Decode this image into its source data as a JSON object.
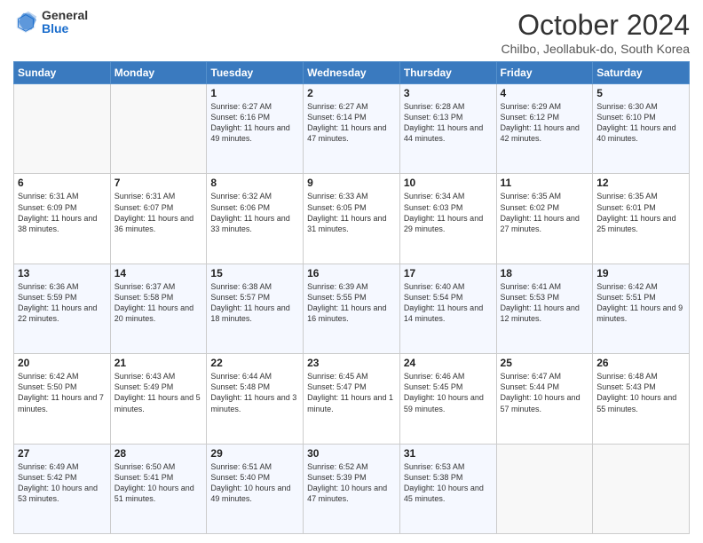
{
  "logo": {
    "general": "General",
    "blue": "Blue"
  },
  "header": {
    "month": "October 2024",
    "location": "Chilbo, Jeollabuk-do, South Korea"
  },
  "days_of_week": [
    "Sunday",
    "Monday",
    "Tuesday",
    "Wednesday",
    "Thursday",
    "Friday",
    "Saturday"
  ],
  "weeks": [
    [
      {
        "day": "",
        "info": ""
      },
      {
        "day": "",
        "info": ""
      },
      {
        "day": "1",
        "info": "Sunrise: 6:27 AM\nSunset: 6:16 PM\nDaylight: 11 hours and 49 minutes."
      },
      {
        "day": "2",
        "info": "Sunrise: 6:27 AM\nSunset: 6:14 PM\nDaylight: 11 hours and 47 minutes."
      },
      {
        "day": "3",
        "info": "Sunrise: 6:28 AM\nSunset: 6:13 PM\nDaylight: 11 hours and 44 minutes."
      },
      {
        "day": "4",
        "info": "Sunrise: 6:29 AM\nSunset: 6:12 PM\nDaylight: 11 hours and 42 minutes."
      },
      {
        "day": "5",
        "info": "Sunrise: 6:30 AM\nSunset: 6:10 PM\nDaylight: 11 hours and 40 minutes."
      }
    ],
    [
      {
        "day": "6",
        "info": "Sunrise: 6:31 AM\nSunset: 6:09 PM\nDaylight: 11 hours and 38 minutes."
      },
      {
        "day": "7",
        "info": "Sunrise: 6:31 AM\nSunset: 6:07 PM\nDaylight: 11 hours and 36 minutes."
      },
      {
        "day": "8",
        "info": "Sunrise: 6:32 AM\nSunset: 6:06 PM\nDaylight: 11 hours and 33 minutes."
      },
      {
        "day": "9",
        "info": "Sunrise: 6:33 AM\nSunset: 6:05 PM\nDaylight: 11 hours and 31 minutes."
      },
      {
        "day": "10",
        "info": "Sunrise: 6:34 AM\nSunset: 6:03 PM\nDaylight: 11 hours and 29 minutes."
      },
      {
        "day": "11",
        "info": "Sunrise: 6:35 AM\nSunset: 6:02 PM\nDaylight: 11 hours and 27 minutes."
      },
      {
        "day": "12",
        "info": "Sunrise: 6:35 AM\nSunset: 6:01 PM\nDaylight: 11 hours and 25 minutes."
      }
    ],
    [
      {
        "day": "13",
        "info": "Sunrise: 6:36 AM\nSunset: 5:59 PM\nDaylight: 11 hours and 22 minutes."
      },
      {
        "day": "14",
        "info": "Sunrise: 6:37 AM\nSunset: 5:58 PM\nDaylight: 11 hours and 20 minutes."
      },
      {
        "day": "15",
        "info": "Sunrise: 6:38 AM\nSunset: 5:57 PM\nDaylight: 11 hours and 18 minutes."
      },
      {
        "day": "16",
        "info": "Sunrise: 6:39 AM\nSunset: 5:55 PM\nDaylight: 11 hours and 16 minutes."
      },
      {
        "day": "17",
        "info": "Sunrise: 6:40 AM\nSunset: 5:54 PM\nDaylight: 11 hours and 14 minutes."
      },
      {
        "day": "18",
        "info": "Sunrise: 6:41 AM\nSunset: 5:53 PM\nDaylight: 11 hours and 12 minutes."
      },
      {
        "day": "19",
        "info": "Sunrise: 6:42 AM\nSunset: 5:51 PM\nDaylight: 11 hours and 9 minutes."
      }
    ],
    [
      {
        "day": "20",
        "info": "Sunrise: 6:42 AM\nSunset: 5:50 PM\nDaylight: 11 hours and 7 minutes."
      },
      {
        "day": "21",
        "info": "Sunrise: 6:43 AM\nSunset: 5:49 PM\nDaylight: 11 hours and 5 minutes."
      },
      {
        "day": "22",
        "info": "Sunrise: 6:44 AM\nSunset: 5:48 PM\nDaylight: 11 hours and 3 minutes."
      },
      {
        "day": "23",
        "info": "Sunrise: 6:45 AM\nSunset: 5:47 PM\nDaylight: 11 hours and 1 minute."
      },
      {
        "day": "24",
        "info": "Sunrise: 6:46 AM\nSunset: 5:45 PM\nDaylight: 10 hours and 59 minutes."
      },
      {
        "day": "25",
        "info": "Sunrise: 6:47 AM\nSunset: 5:44 PM\nDaylight: 10 hours and 57 minutes."
      },
      {
        "day": "26",
        "info": "Sunrise: 6:48 AM\nSunset: 5:43 PM\nDaylight: 10 hours and 55 minutes."
      }
    ],
    [
      {
        "day": "27",
        "info": "Sunrise: 6:49 AM\nSunset: 5:42 PM\nDaylight: 10 hours and 53 minutes."
      },
      {
        "day": "28",
        "info": "Sunrise: 6:50 AM\nSunset: 5:41 PM\nDaylight: 10 hours and 51 minutes."
      },
      {
        "day": "29",
        "info": "Sunrise: 6:51 AM\nSunset: 5:40 PM\nDaylight: 10 hours and 49 minutes."
      },
      {
        "day": "30",
        "info": "Sunrise: 6:52 AM\nSunset: 5:39 PM\nDaylight: 10 hours and 47 minutes."
      },
      {
        "day": "31",
        "info": "Sunrise: 6:53 AM\nSunset: 5:38 PM\nDaylight: 10 hours and 45 minutes."
      },
      {
        "day": "",
        "info": ""
      },
      {
        "day": "",
        "info": ""
      }
    ]
  ]
}
